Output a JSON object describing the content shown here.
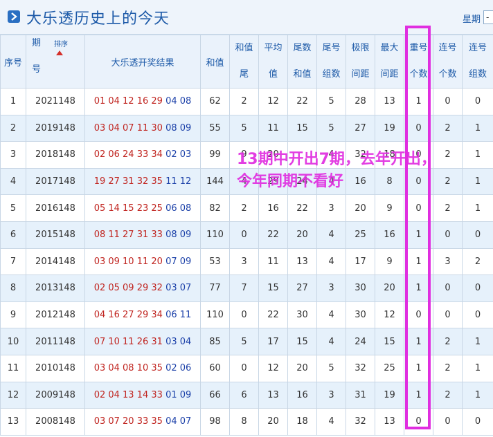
{
  "header": {
    "title": "大乐透历史上的今天",
    "right_label": "星期",
    "select_value": "-"
  },
  "columns": {
    "index": "序号",
    "period_top": "期",
    "period_bottom": "号",
    "sort_label": "排序",
    "result": "大乐透开奖结果",
    "sum": "和值",
    "sum_tail": [
      "和值",
      "尾"
    ],
    "average": [
      "平均",
      "值"
    ],
    "tail_sum": [
      "尾数",
      "和值"
    ],
    "tail_groups": [
      "尾号",
      "组数"
    ],
    "range": [
      "极限",
      "间距"
    ],
    "max_gap": [
      "最大",
      "间距"
    ],
    "repeat_count": [
      "重号",
      "个数"
    ],
    "consec_count": [
      "连号",
      "个数"
    ],
    "consec_groups": [
      "连号",
      "组数"
    ]
  },
  "rows": [
    {
      "index": "1",
      "period": "2021148",
      "front": "01 04 12 16 29",
      "back": "04 08",
      "sum": "62",
      "sum_tail": "2",
      "avg": "12",
      "tail_sum": "22",
      "tail_groups": "5",
      "range": "28",
      "max_gap": "13",
      "repeat": "1",
      "consec": "0",
      "consec_groups": "0"
    },
    {
      "index": "2",
      "period": "2019148",
      "front": "03 04 07 11 30",
      "back": "08 09",
      "sum": "55",
      "sum_tail": "5",
      "avg": "11",
      "tail_sum": "15",
      "tail_groups": "5",
      "range": "27",
      "max_gap": "19",
      "repeat": "0",
      "consec": "2",
      "consec_groups": "1"
    },
    {
      "index": "3",
      "period": "2018148",
      "front": "02 06 24 33 34",
      "back": "02 03",
      "sum": "99",
      "sum_tail": "9",
      "avg": "20",
      "tail_sum": "",
      "tail_groups": "4",
      "range": "32",
      "max_gap": "18",
      "repeat": "0",
      "consec": "2",
      "consec_groups": "1"
    },
    {
      "index": "4",
      "period": "2017148",
      "front": "19 27 31 32 35",
      "back": "11 12",
      "sum": "144",
      "sum_tail": "4",
      "avg": "29",
      "tail_sum": "24",
      "tail_groups": "4",
      "range": "16",
      "max_gap": "8",
      "repeat": "0",
      "consec": "2",
      "consec_groups": "1"
    },
    {
      "index": "5",
      "period": "2016148",
      "front": "05 14 15 23 25",
      "back": "06 08",
      "sum": "82",
      "sum_tail": "2",
      "avg": "16",
      "tail_sum": "22",
      "tail_groups": "3",
      "range": "20",
      "max_gap": "9",
      "repeat": "0",
      "consec": "2",
      "consec_groups": "1"
    },
    {
      "index": "6",
      "period": "2015148",
      "front": "08 11 27 31 33",
      "back": "08 09",
      "sum": "110",
      "sum_tail": "0",
      "avg": "22",
      "tail_sum": "20",
      "tail_groups": "4",
      "range": "25",
      "max_gap": "16",
      "repeat": "1",
      "consec": "0",
      "consec_groups": "0"
    },
    {
      "index": "7",
      "period": "2014148",
      "front": "03 09 10 11 20",
      "back": "07 09",
      "sum": "53",
      "sum_tail": "3",
      "avg": "11",
      "tail_sum": "13",
      "tail_groups": "4",
      "range": "17",
      "max_gap": "9",
      "repeat": "1",
      "consec": "3",
      "consec_groups": "2"
    },
    {
      "index": "8",
      "period": "2013148",
      "front": "02 05 09 29 32",
      "back": "03 07",
      "sum": "77",
      "sum_tail": "7",
      "avg": "15",
      "tail_sum": "27",
      "tail_groups": "3",
      "range": "30",
      "max_gap": "20",
      "repeat": "1",
      "consec": "0",
      "consec_groups": "0"
    },
    {
      "index": "9",
      "period": "2012148",
      "front": "04 16 27 29 34",
      "back": "06 11",
      "sum": "110",
      "sum_tail": "0",
      "avg": "22",
      "tail_sum": "30",
      "tail_groups": "4",
      "range": "30",
      "max_gap": "12",
      "repeat": "0",
      "consec": "0",
      "consec_groups": "0"
    },
    {
      "index": "10",
      "period": "2011148",
      "front": "07 10 11 26 31",
      "back": "03 04",
      "sum": "85",
      "sum_tail": "5",
      "avg": "17",
      "tail_sum": "15",
      "tail_groups": "4",
      "range": "24",
      "max_gap": "15",
      "repeat": "1",
      "consec": "2",
      "consec_groups": "1"
    },
    {
      "index": "11",
      "period": "2010148",
      "front": "03 04 08 10 35",
      "back": "02 06",
      "sum": "60",
      "sum_tail": "0",
      "avg": "12",
      "tail_sum": "20",
      "tail_groups": "5",
      "range": "32",
      "max_gap": "25",
      "repeat": "1",
      "consec": "2",
      "consec_groups": "1"
    },
    {
      "index": "12",
      "period": "2009148",
      "front": "02 04 13 14 33",
      "back": "01 09",
      "sum": "66",
      "sum_tail": "6",
      "avg": "13",
      "tail_sum": "16",
      "tail_groups": "3",
      "range": "31",
      "max_gap": "19",
      "repeat": "1",
      "consec": "2",
      "consec_groups": "1"
    },
    {
      "index": "13",
      "period": "2008148",
      "front": "03 07 20 33 35",
      "back": "04 07",
      "sum": "98",
      "sum_tail": "8",
      "avg": "20",
      "tail_sum": "18",
      "tail_groups": "4",
      "range": "32",
      "max_gap": "13",
      "repeat": "0",
      "consec": "0",
      "consec_groups": "0"
    }
  ],
  "annotation": {
    "line1": "13期中开出7期，去年开出，",
    "line2": "今年同期不看好"
  },
  "colors": {
    "front_balls": "#c0241f",
    "back_balls": "#1a3fa8",
    "highlight": "#e02ee0",
    "header_blue": "#1d5aa8"
  }
}
